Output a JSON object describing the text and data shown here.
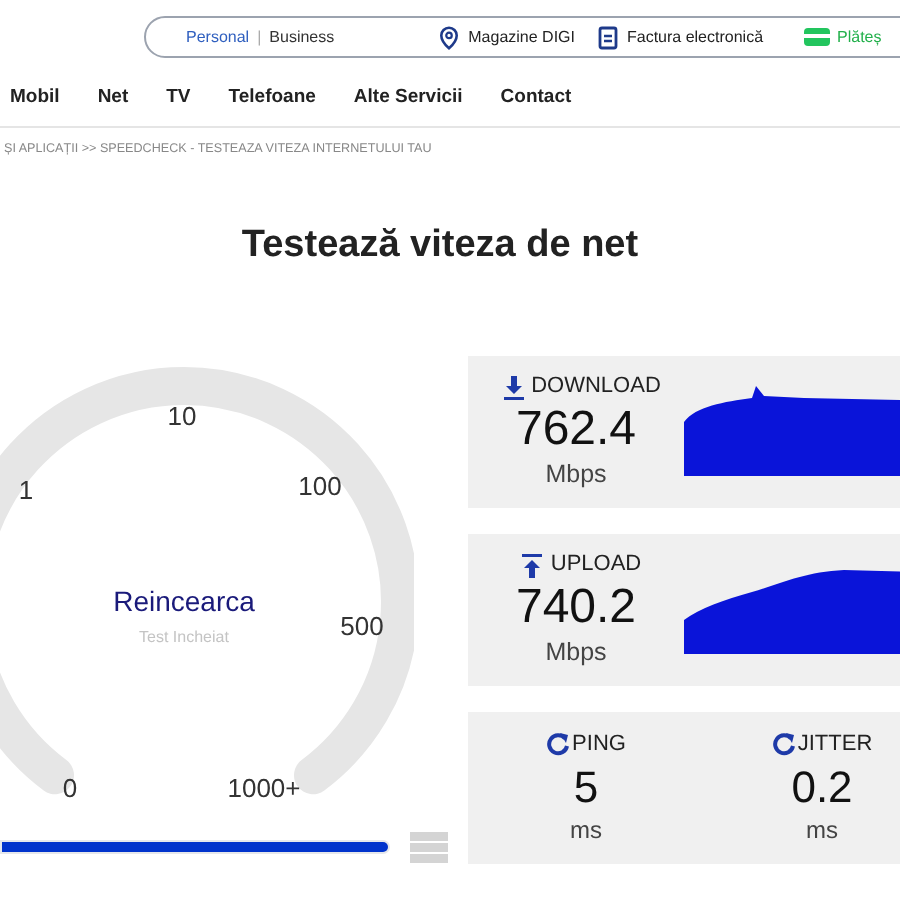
{
  "topbar": {
    "segments": [
      {
        "label": "Personal",
        "selected": true
      },
      {
        "label": "Business",
        "selected": false
      }
    ],
    "separator": "|",
    "links": [
      {
        "kind": "pin",
        "label": "Magazine DIGI"
      },
      {
        "kind": "document",
        "label": "Factura electronică"
      },
      {
        "kind": "card",
        "label": "Plăteș"
      }
    ]
  },
  "nav": [
    "Mobil",
    "Net",
    "TV",
    "Telefoane",
    "Alte Servicii",
    "Contact"
  ],
  "breadcrumb": "ȘI APLICAȚII >> SPEEDCHECK - TESTEAZA VITEZA INTERNETULUI TAU",
  "title": "Testează viteza de net",
  "gauge": {
    "button": "Reincearca",
    "status": "Test Incheiat",
    "scale": [
      "0",
      "1",
      "10",
      "100",
      "500",
      "1000+"
    ]
  },
  "progress": {
    "level": 1
  },
  "metrics": [
    {
      "kind": "download",
      "label": "DOWNLOAD",
      "value": "762.4",
      "unit": "Mbps"
    },
    {
      "kind": "upload",
      "label": "UPLOAD",
      "value": "740.2",
      "unit": "Mbps"
    }
  ],
  "latency": [
    {
      "label": "PING",
      "value": "5",
      "unit": "ms"
    },
    {
      "label": "JITTER",
      "value": "0.2",
      "unit": "ms"
    }
  ]
}
